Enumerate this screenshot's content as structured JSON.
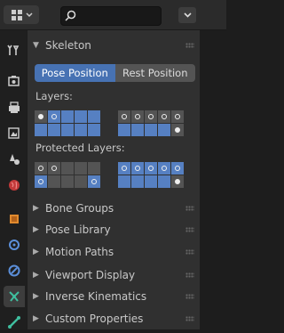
{
  "panel": {
    "title": "Skeleton",
    "pose_position": "Pose Position",
    "rest_position": "Rest Position",
    "layers_label": "Layers:",
    "protected_layers_label": "Protected Layers:",
    "sections": [
      {
        "label": "Bone Groups"
      },
      {
        "label": "Pose Library"
      },
      {
        "label": "Motion Paths"
      },
      {
        "label": "Viewport Display"
      },
      {
        "label": "Inverse Kinematics"
      },
      {
        "label": "Custom Properties"
      }
    ]
  },
  "colors": {
    "accent": "#4772b3",
    "panel": "#303030",
    "layer_on": "#5680c2",
    "layer_off": "#545454"
  },
  "sidebar_tabs": [
    "tool-icon",
    "render-icon",
    "output-icon",
    "view-layer-icon",
    "scene-icon",
    "world-icon",
    "object-icon",
    "modifier-icon",
    "particles-icon",
    "armature-data-icon",
    "bone-icon"
  ]
}
